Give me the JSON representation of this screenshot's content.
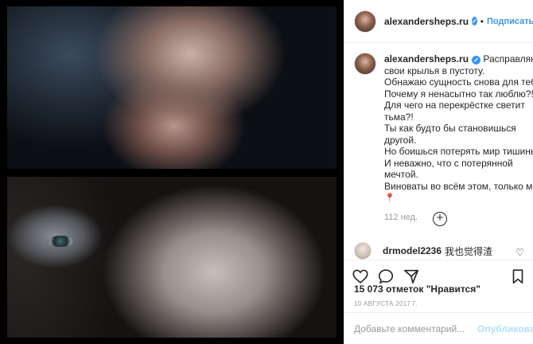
{
  "post": {
    "author": "alexandersheps.ru",
    "separator": "•",
    "follow_label": "Подписаться",
    "verified_icon": "verified-badge-icon",
    "caption": {
      "lines": [
        "Расправляю",
        "свои крылья в пустоту.",
        "Обнажаю сущность снова для тебя.",
        "Почему я ненасытно так люблю?!",
        "Для чего на перекрёстке светит",
        "тьма?!",
        "Ты как будто бы становишься",
        "другой.",
        "Но боишься потерять мир тишины",
        "И неважно, что с потерянной",
        "мечтой.",
        "Виноваты во всём этом, только мы..."
      ],
      "emoji": "📍",
      "time_ago": "112 нед."
    },
    "comments": [
      {
        "user": "drmodel2236",
        "text": "我也觉得渣"
      }
    ],
    "likes_text": "15 073 отметок \"Нравится\"",
    "date": "10 АВГУСТА 2017 Г.",
    "comment_placeholder": "Добавьте комментарий...",
    "publish_label": "Опубликовать",
    "colors": {
      "accent": "#3897f0",
      "publish_disabled": "#b2dffc",
      "muted": "#999999"
    }
  }
}
